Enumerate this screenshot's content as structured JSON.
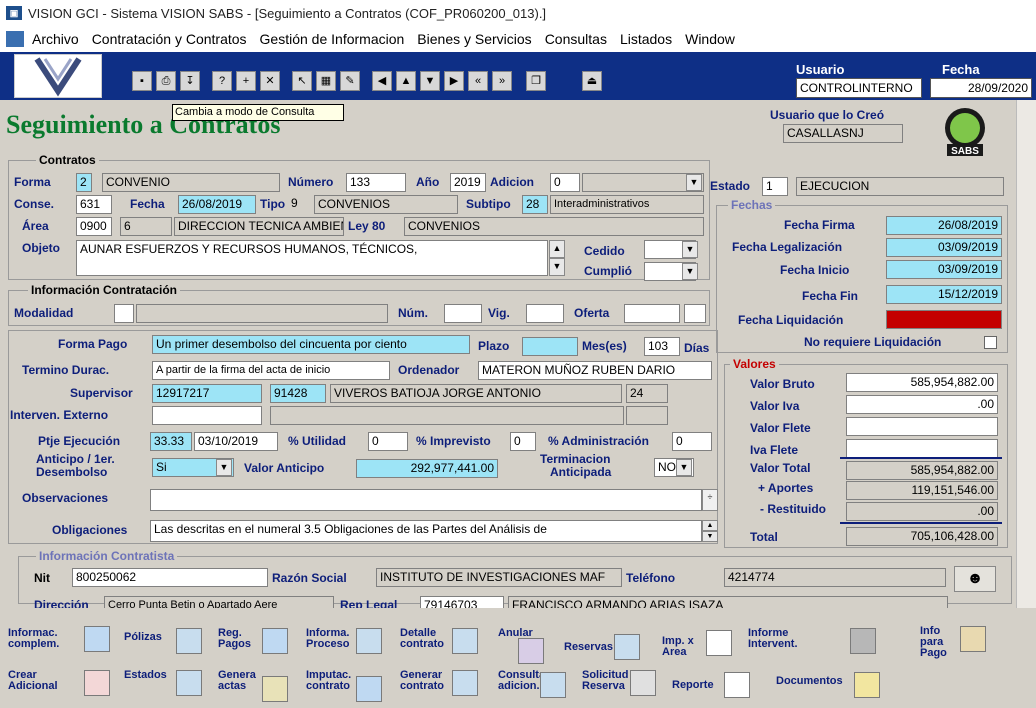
{
  "window": {
    "title": "VISION GCI - Sistema VISION SABS - [Seguimiento a Contratos (COF_PR060200_013).]"
  },
  "menu": [
    "Archivo",
    "Contratación y Contratos",
    "Gestión de Informacion",
    "Bienes y Servicios",
    "Consultas",
    "Listados",
    "Window"
  ],
  "toolbar": {
    "tooltip": "Cambia a modo de Consulta",
    "usuario_label": "Usuario",
    "usuario_value": "CONTROLINTERNO",
    "fecha_label": "Fecha",
    "fecha_value": "28/09/2020",
    "icons": [
      "save-icon",
      "print-icon",
      "download-icon",
      "query-mode-icon",
      "insert-record-icon",
      "delete-record-icon",
      "clear-icon",
      "edit-record-icon",
      "pencil-icon",
      "prev-icon",
      "up-icon",
      "down-icon",
      "next-icon",
      "first-icon",
      "last-icon",
      "copy-icon",
      "exit-icon"
    ]
  },
  "page": {
    "title": "Seguimiento a Contratos",
    "creator_label": "Usuario que lo Creó",
    "creator_value": "CASALLASNJ",
    "sabs_logo": "SABS"
  },
  "contratos": {
    "group_label": "Contratos",
    "forma_label": "Forma",
    "forma_code": "2",
    "forma_desc": "CONVENIO",
    "numero_label": "Número",
    "numero": "133",
    "anio_label": "Año",
    "anio": "2019",
    "adicion_label": "Adicion",
    "adicion": "0",
    "estado_label": "Estado",
    "estado_code": "1",
    "estado_desc": "EJECUCION",
    "conse_label": "Conse.",
    "conse": "631",
    "fecha_label": "Fecha",
    "fecha": "26/08/2019",
    "tipo_label": "Tipo",
    "tipo_code": "9",
    "tipo_desc": "CONVENIOS",
    "subtipo_label": "Subtipo",
    "subtipo_code": "28",
    "subtipo_desc": "Interadministrativos",
    "area_label": "Área",
    "area_code": "0900",
    "area_sub": "6",
    "area_desc": "DIRECCION TECNICA AMBIENTA",
    "ley80_label": "Ley 80",
    "ley80": "CONVENIOS",
    "objeto_label": "Objeto",
    "objeto": "AUNAR ESFUERZOS Y RECURSOS HUMANOS, TÉCNICOS,",
    "cedido_label": "Cedido",
    "cumplio_label": "Cumplió"
  },
  "fechas": {
    "group_label": "Fechas",
    "firma_label": "Fecha Firma",
    "firma": "26/08/2019",
    "legalizacion_label": "Fecha Legalización",
    "legalizacion": "03/09/2019",
    "inicio_label": "Fecha Inicio",
    "inicio": "03/09/2019",
    "fin_label": "Fecha Fin",
    "fin": "15/12/2019",
    "liquidacion_label": "Fecha Liquidación",
    "no_liq_label": "No requiere Liquidación"
  },
  "contratacion": {
    "group_label": "Información Contratación",
    "modalidad_label": "Modalidad",
    "num_label": "Núm.",
    "vig_label": "Vig.",
    "oferta_label": "Oferta"
  },
  "detalle": {
    "forma_pago_label": "Forma Pago",
    "forma_pago": "Un primer desembolso del cincuenta por ciento",
    "plazo_label": "Plazo",
    "meses_label": "Mes(es)",
    "meses": "103",
    "dias_label": "Días",
    "termino_label": "Termino Durac.",
    "termino": "A partir de la firma del acta de inicio",
    "ordenador_label": "Ordenador",
    "ordenador": "MATERON MUÑOZ RUBEN DARIO",
    "supervisor_label": "Supervisor",
    "supervisor_id": "12917217",
    "supervisor_code": "91428",
    "supervisor_name": "VIVEROS BATIOJA JORGE ANTONIO",
    "supervisor_num": "24",
    "interventor_label": "Interven. Externo",
    "ptje_label": "Ptje Ejecución",
    "ptje": "33.33",
    "ptje_fecha": "03/10/2019",
    "utilidad_label": "% Utilidad",
    "utilidad": "0",
    "imprevisto_label": "% Imprevisto",
    "imprevisto": "0",
    "admin_label": "% Administración",
    "admin": "0",
    "anticipo_label1": "Anticipo / 1er.",
    "anticipo_label2": "Desembolso",
    "anticipo": "Si",
    "valor_anticipo_label": "Valor Anticipo",
    "valor_anticipo": "292,977,441.00",
    "term_anticipada_label1": "Terminacion",
    "term_anticipada_label2": "Anticipada",
    "term_anticipada": "NO",
    "observaciones_label": "Observaciones",
    "obligaciones_label": "Obligaciones",
    "obligaciones": "Las descritas en el numeral 3.5 Obligaciones de las Partes del Análisis de"
  },
  "valores": {
    "group_label": "Valores",
    "bruto_label": "Valor Bruto",
    "bruto": "585,954,882.00",
    "iva_label": "Valor Iva",
    "iva": ".00",
    "flete_label": "Valor Flete",
    "iva_flete_label": "Iva Flete",
    "total_label": "Valor Total",
    "total": "585,954,882.00",
    "aportes_label": "+ Aportes",
    "aportes": "119,151,546.00",
    "restituido_label": "- Restituido",
    "restituido": ".00",
    "gran_total_label": "Total",
    "gran_total": "705,106,428.00"
  },
  "contratista": {
    "group_label": "Información Contratista",
    "nit_label": "Nit",
    "nit": "800250062",
    "razon_label": "Razón Social",
    "razon": "INSTITUTO DE INVESTIGACIONES MAF",
    "telefono_label": "Teléfono",
    "telefono": "4214774",
    "direccion_label": "Dirección",
    "direccion": "Cerro Punta Betin  o Apartado Aere",
    "rep_label": "Rep Legal",
    "rep_id": "79146703",
    "rep_name": "FRANCISCO ARMANDO ARIAS ISAZA"
  },
  "actions": {
    "informac_1": "Informac.",
    "informac_2": "complem.",
    "polizas": "Pólizas",
    "reg_pagos_1": "Reg.",
    "reg_pagos_2": "Pagos",
    "informa_1": "Informa.",
    "informa_2": "Proceso",
    "detalle_1": "Detalle",
    "detalle_2": "contrato",
    "anular": "Anular",
    "reservas": "Reservas",
    "imp_area_1": "Imp. x",
    "imp_area_2": "Area",
    "informe_1": "Informe",
    "informe_2": "Intervent.",
    "info_pago_1": "Info",
    "info_pago_2": "para",
    "info_pago_3": "Pago",
    "crear_1": "Crear",
    "crear_2": "Adicional",
    "estados": "Estados",
    "genera_1": "Genera",
    "genera_2": "actas",
    "imputac_1": "Imputac.",
    "imputac_2": "contrato",
    "generar_1": "Generar",
    "generar_2": "contrato",
    "consulta_1": "Consulta",
    "consulta_2": "adicion.",
    "solicitud_1": "Solicitud",
    "solicitud_2": "Reserva",
    "reporte": "Reporte",
    "documentos": "Documentos"
  }
}
